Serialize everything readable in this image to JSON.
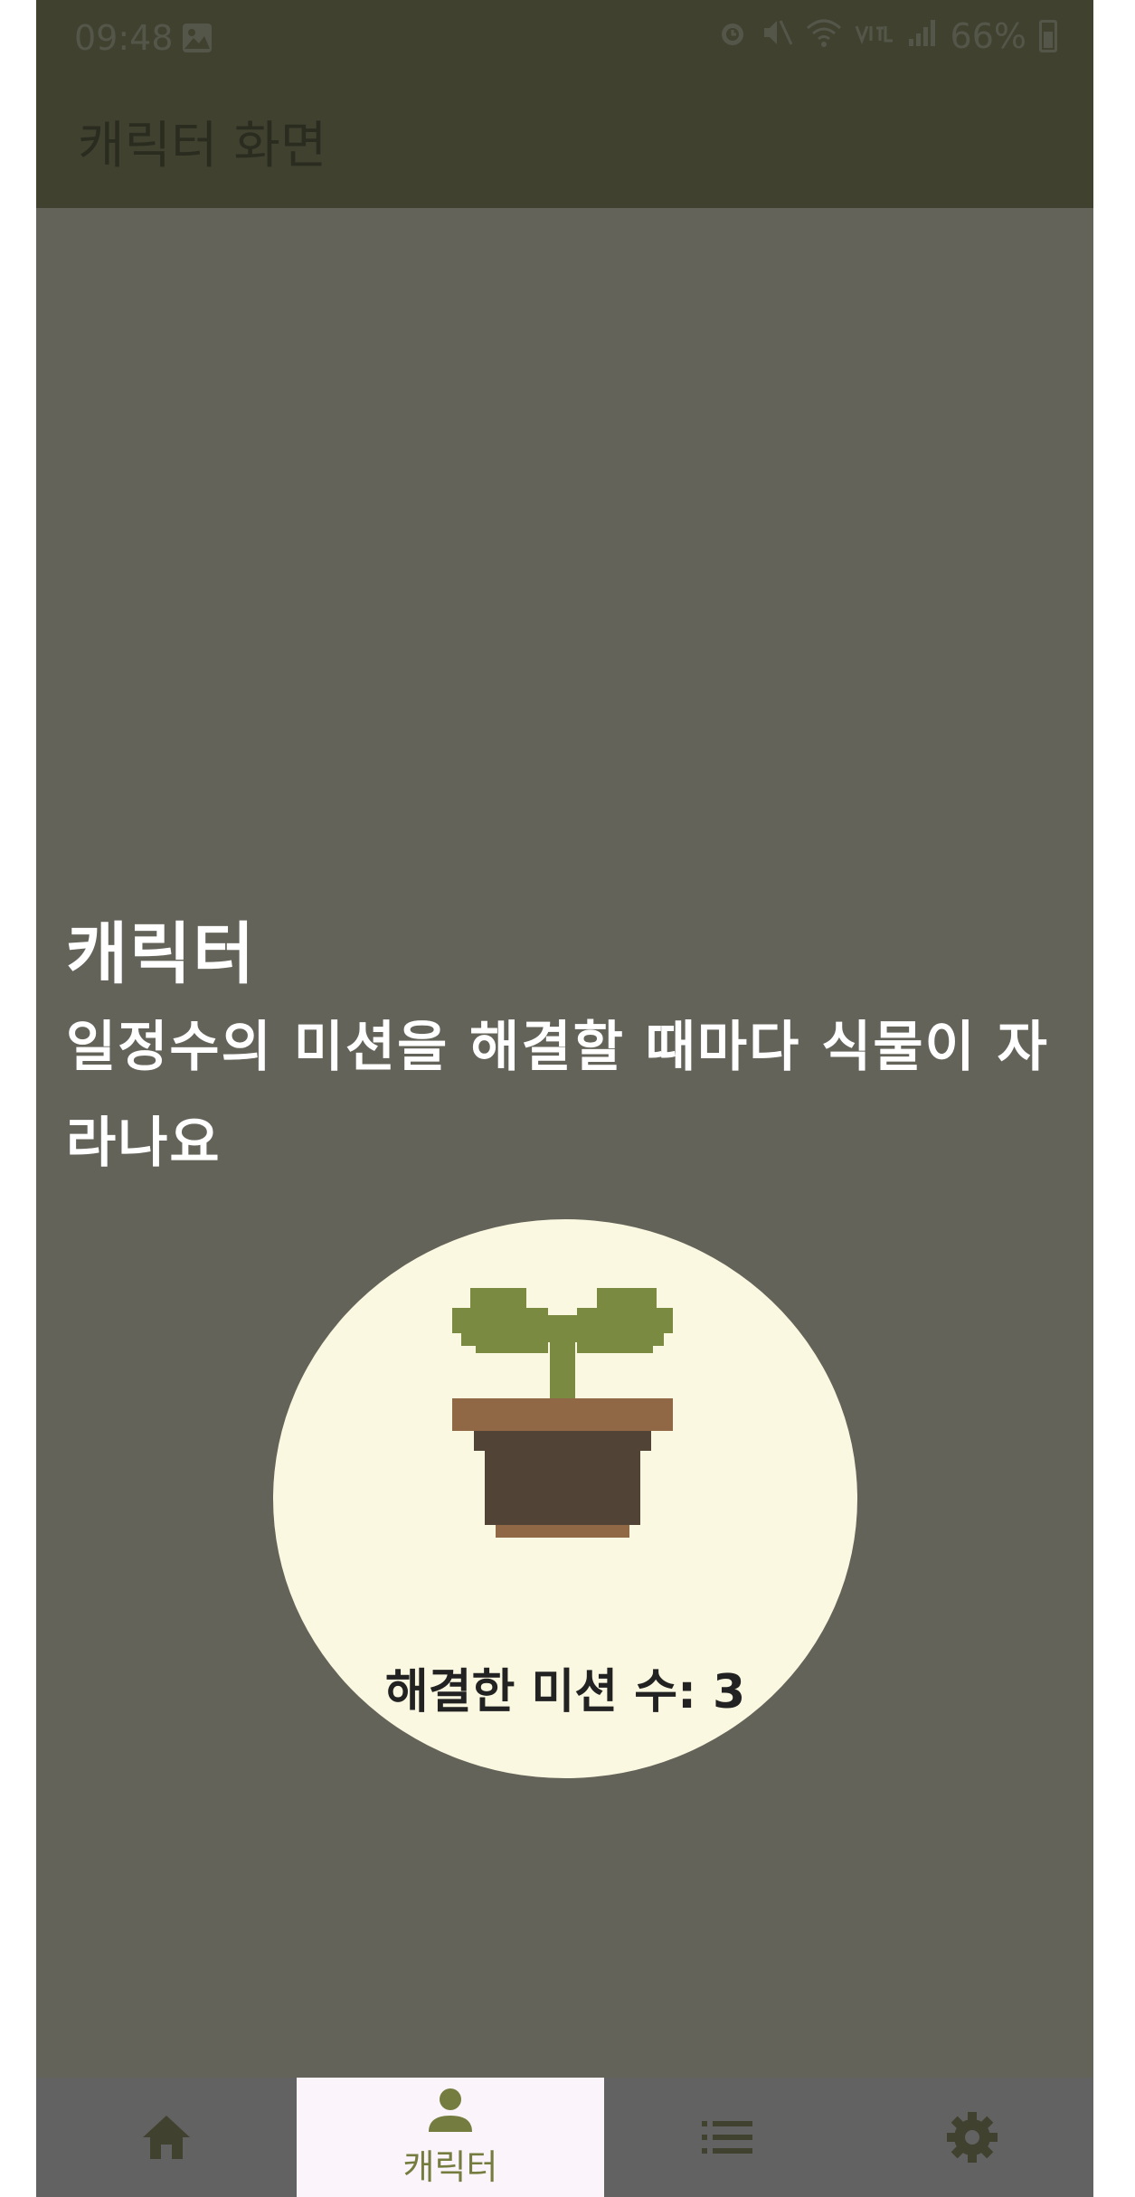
{
  "status_bar": {
    "time": "09:48",
    "battery": "66%",
    "icons": [
      "image-icon",
      "alarm-icon",
      "mute-icon",
      "wifi-icon",
      "volte-icon",
      "signal-icon",
      "battery-icon"
    ]
  },
  "app_bar": {
    "title": "캐릭터 화면"
  },
  "main": {
    "heading": "캐릭터",
    "description": "일정수의 미션을 해결할 때마다 식물이 자라나요",
    "mission_count_label": "해결한 미션 수: 3",
    "mission_count": 3,
    "plant_icon": "sprout-in-pot"
  },
  "bottom_nav": {
    "items": [
      {
        "icon": "home-icon",
        "label": "",
        "selected": false
      },
      {
        "icon": "person-icon",
        "label": "캐릭터",
        "selected": true
      },
      {
        "icon": "list-icon",
        "label": "",
        "selected": false
      },
      {
        "icon": "gear-icon",
        "label": "",
        "selected": false
      }
    ]
  },
  "colors": {
    "background": "#646359",
    "app_bar": "#40412f",
    "circle": "#fbf8e1",
    "accent": "#747d3f",
    "nav_selected": "#fbf4fb"
  }
}
